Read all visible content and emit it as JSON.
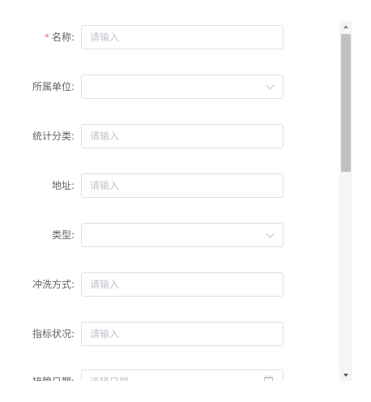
{
  "form": {
    "fields": [
      {
        "label": "名称:",
        "required_mark": "*",
        "type": "input",
        "value": "",
        "placeholder": "请输入"
      },
      {
        "label": "所属单位:",
        "type": "select",
        "value": "",
        "placeholder": ""
      },
      {
        "label": "统计分类:",
        "type": "input",
        "value": "",
        "placeholder": "请输入"
      },
      {
        "label": "地址:",
        "type": "input",
        "value": "",
        "placeholder": "请输入"
      },
      {
        "label": "类型:",
        "type": "select",
        "value": "",
        "placeholder": ""
      },
      {
        "label": "冲洗方式:",
        "type": "input",
        "value": "",
        "placeholder": "请输入"
      },
      {
        "label": "指标状况:",
        "type": "input",
        "value": "",
        "placeholder": "请输入"
      },
      {
        "label": "接管日期:",
        "type": "date",
        "value": "",
        "placeholder": "选择日期"
      }
    ]
  },
  "icons": {
    "select_arrow": "chevron-down-icon",
    "date": "calendar-icon",
    "scroll_up": "scroll-up-arrow-icon",
    "scroll_down": "scroll-down-arrow-icon"
  },
  "colors": {
    "required": "#f56c6c",
    "label": "#606266",
    "placeholder": "#c0c4cc",
    "border": "#dcdfe6"
  }
}
